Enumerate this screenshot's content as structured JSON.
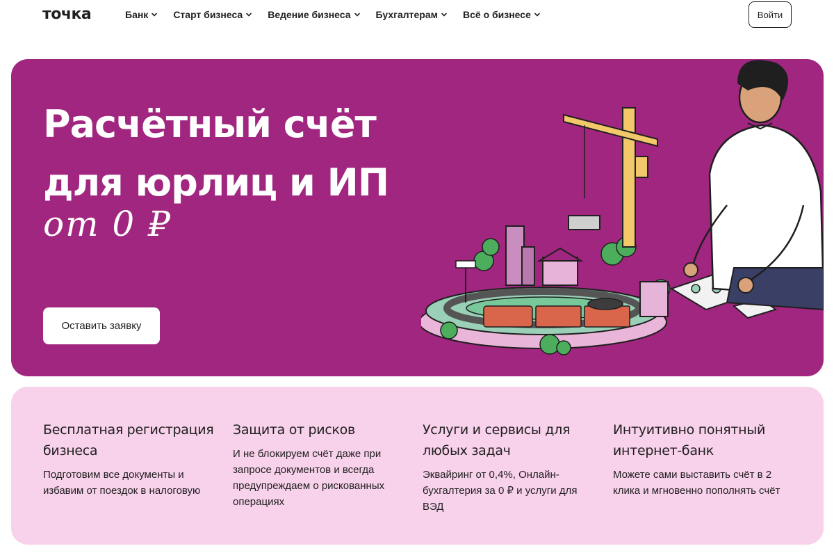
{
  "header": {
    "logo": "точка",
    "nav": [
      {
        "label": "Банк"
      },
      {
        "label": "Старт бизнеса"
      },
      {
        "label": "Ведение бизнеса"
      },
      {
        "label": "Бухгалтерам"
      },
      {
        "label": "Всё о бизнесе"
      }
    ],
    "login_label": "Войти"
  },
  "hero": {
    "title_line1": "Расчётный счёт",
    "title_line2": "для юрлиц и ИП",
    "script_text": "от 0 ₽",
    "cta_label": "Оставить заявку"
  },
  "features": [
    {
      "title": "Бесплатная регистрация бизнеса",
      "text": "Подготовим все документы и избавим от поездок в налоговую"
    },
    {
      "title": "Защита от рисков",
      "text": "И не блокируем счёт даже при запросе документов и всегда предупреждаем о рискованных операциях"
    },
    {
      "title": "Услуги и сервисы для любых задач",
      "text": "Эквайринг от 0,4%, Онлайн-бухгалтерия за 0 ₽ и услуги для ВЭД"
    },
    {
      "title": "Интуитивно понятный интернет-банк",
      "text": "Можете сами выставить счёт в 2 клика и мгновенно пополнять счёт"
    }
  ],
  "colors": {
    "hero_bg": "#a1267f",
    "features_bg": "#f8d1ea",
    "text": "#1f1f1f"
  }
}
